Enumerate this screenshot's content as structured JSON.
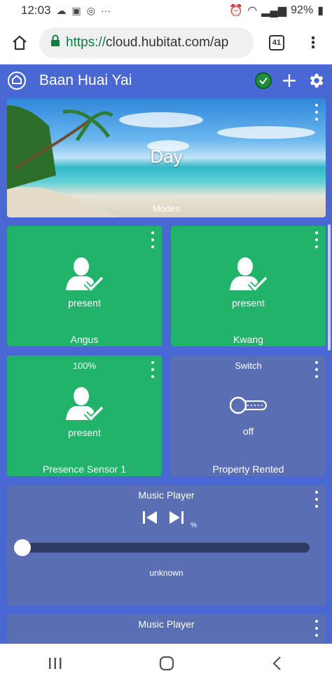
{
  "status_bar": {
    "time": "12:03",
    "battery": "92%"
  },
  "browser": {
    "url_scheme": "https://",
    "url_rest": "cloud.hubitat.com/ap",
    "tab_count": "41"
  },
  "app": {
    "title": "Baan Huai Yai"
  },
  "modes_tile": {
    "value": "Day",
    "label": "Modes"
  },
  "tiles": [
    {
      "top": "",
      "state": "present",
      "name": "Angus"
    },
    {
      "top": "",
      "state": "present",
      "name": "Kwang"
    },
    {
      "top": "100%",
      "state": "present",
      "name": "Presence Sensor 1"
    },
    {
      "top": "Switch",
      "state": "off",
      "name": "Property Rented"
    }
  ],
  "music1": {
    "title": "Music Player",
    "percent": "%",
    "status": "unknown",
    "progress": 0
  },
  "music2": {
    "title": "Music Player"
  }
}
